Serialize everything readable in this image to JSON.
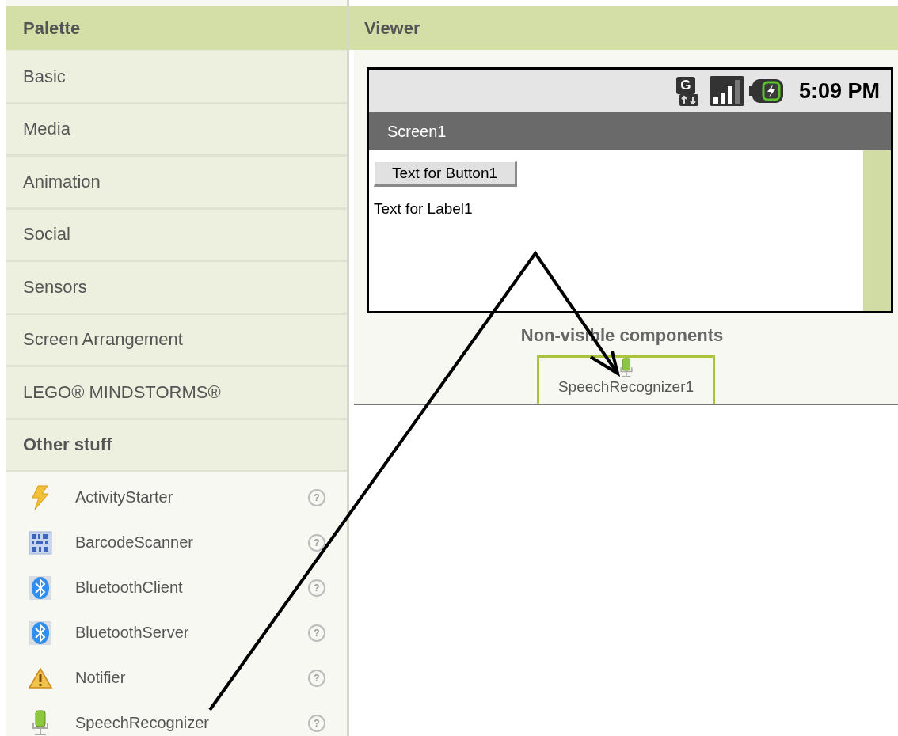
{
  "palette": {
    "title": "Palette",
    "categories": [
      {
        "label": "Basic",
        "expanded": false
      },
      {
        "label": "Media",
        "expanded": false
      },
      {
        "label": "Animation",
        "expanded": false
      },
      {
        "label": "Social",
        "expanded": false
      },
      {
        "label": "Sensors",
        "expanded": false
      },
      {
        "label": "Screen Arrangement",
        "expanded": false
      },
      {
        "label": "LEGO® MINDSTORMS®",
        "expanded": false
      },
      {
        "label": "Other stuff",
        "expanded": true
      }
    ],
    "items": [
      {
        "label": "ActivityStarter",
        "kind": "lightning",
        "help": "?"
      },
      {
        "label": "BarcodeScanner",
        "kind": "barcode",
        "help": "?"
      },
      {
        "label": "BluetoothClient",
        "kind": "bluetooth",
        "help": "?"
      },
      {
        "label": "BluetoothServer",
        "kind": "bluetooth",
        "help": "?"
      },
      {
        "label": "Notifier",
        "kind": "warning",
        "help": "?"
      },
      {
        "label": "SpeechRecognizer",
        "kind": "microphone",
        "help": "?"
      }
    ]
  },
  "viewer": {
    "title": "Viewer",
    "phone": {
      "network_type": "G",
      "time": "5:09 PM",
      "screen_title": "Screen1",
      "components": [
        {
          "kind": "button",
          "text": "Text for Button1"
        },
        {
          "kind": "label",
          "text": "Text for Label1"
        }
      ]
    },
    "nonvisible": {
      "title": "Non-visible components",
      "items": [
        {
          "label": "SpeechRecognizer1",
          "kind": "microphone"
        }
      ]
    }
  }
}
